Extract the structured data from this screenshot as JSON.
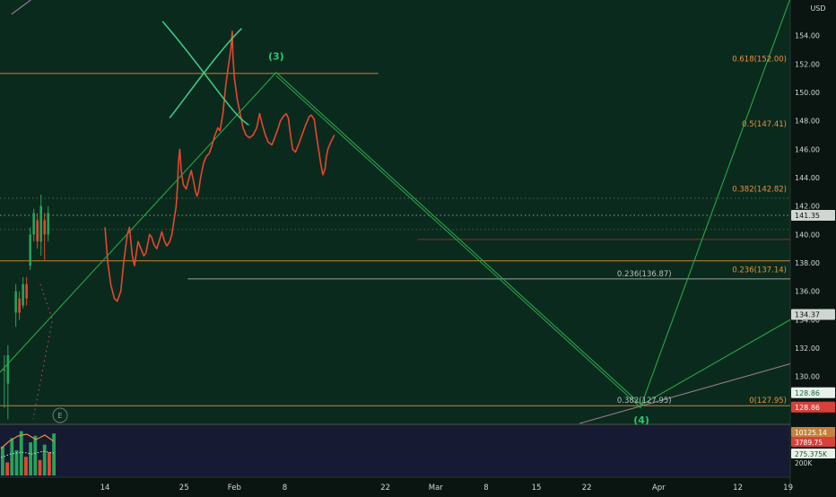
{
  "chart_data": {
    "type": "line",
    "currency": "USD",
    "y_ticks": [
      130,
      132,
      134,
      136,
      138,
      140,
      142,
      144,
      146,
      148,
      150,
      152,
      154
    ],
    "ylim": [
      126.7,
      156.5
    ],
    "x_ticks": [
      {
        "label": "14",
        "day": 14
      },
      {
        "label": "25",
        "day": 25
      },
      {
        "label": "Feb",
        "day": 32
      },
      {
        "label": "8",
        "day": 39
      },
      {
        "label": "22",
        "day": 53
      },
      {
        "label": "Mar",
        "day": 60
      },
      {
        "label": "8",
        "day": 67
      },
      {
        "label": "15",
        "day": 74
      },
      {
        "label": "22",
        "day": 81
      },
      {
        "label": "Apr",
        "day": 91
      },
      {
        "label": "12",
        "day": 102
      },
      {
        "label": "19",
        "day": 109
      }
    ],
    "xlim": [
      -0.6,
      109.3
    ],
    "price_series": {
      "name": "",
      "color": "#e5472e",
      "points": [
        [
          14.0,
          140.5
        ],
        [
          14.4,
          138.0
        ],
        [
          14.8,
          136.5
        ],
        [
          15.3,
          135.5
        ],
        [
          15.7,
          135.3
        ],
        [
          16.2,
          136.0
        ],
        [
          16.6,
          138.0
        ],
        [
          17.1,
          140.0
        ],
        [
          17.4,
          140.5
        ],
        [
          17.8,
          138.5
        ],
        [
          18.1,
          137.8
        ],
        [
          18.6,
          139.5
        ],
        [
          19.0,
          139.0
        ],
        [
          19.4,
          138.5
        ],
        [
          19.7,
          138.7
        ],
        [
          20.2,
          140.0
        ],
        [
          20.5,
          139.8
        ],
        [
          20.8,
          139.3
        ],
        [
          21.2,
          139.0
        ],
        [
          21.7,
          139.8
        ],
        [
          21.9,
          140.2
        ],
        [
          22.3,
          139.5
        ],
        [
          22.6,
          139.2
        ],
        [
          23.0,
          139.5
        ],
        [
          23.3,
          140.0
        ],
        [
          23.6,
          141.0
        ],
        [
          23.9,
          142.0
        ],
        [
          24.1,
          143.5
        ],
        [
          24.2,
          145.0
        ],
        [
          24.4,
          146.0
        ],
        [
          24.6,
          144.5
        ],
        [
          24.9,
          143.5
        ],
        [
          25.3,
          143.2
        ],
        [
          25.6,
          143.8
        ],
        [
          26.0,
          144.5
        ],
        [
          26.3,
          143.8
        ],
        [
          26.6,
          143.0
        ],
        [
          26.8,
          142.7
        ],
        [
          27.0,
          143.0
        ],
        [
          27.3,
          144.0
        ],
        [
          27.7,
          145.0
        ],
        [
          28.1,
          145.5
        ],
        [
          28.5,
          145.7
        ],
        [
          28.9,
          146.3
        ],
        [
          29.3,
          147.0
        ],
        [
          29.7,
          147.5
        ],
        [
          30.0,
          147.3
        ],
        [
          30.4,
          148.5
        ],
        [
          30.8,
          150.5
        ],
        [
          31.2,
          152.0
        ],
        [
          31.5,
          153.0
        ],
        [
          31.7,
          154.3
        ],
        [
          31.8,
          152.5
        ],
        [
          32.0,
          151.0
        ],
        [
          32.4,
          149.5
        ],
        [
          32.8,
          148.5
        ],
        [
          33.2,
          147.5
        ],
        [
          33.6,
          147.0
        ],
        [
          34.1,
          146.8
        ],
        [
          34.6,
          147.0
        ],
        [
          35.1,
          147.5
        ],
        [
          35.5,
          148.5
        ],
        [
          35.9,
          147.7
        ],
        [
          36.3,
          147.0
        ],
        [
          36.7,
          146.5
        ],
        [
          37.2,
          146.3
        ],
        [
          37.6,
          146.8
        ],
        [
          38.1,
          147.5
        ],
        [
          38.4,
          148.0
        ],
        [
          38.8,
          148.3
        ],
        [
          39.2,
          148.5
        ],
        [
          39.5,
          148.2
        ],
        [
          39.8,
          147.0
        ],
        [
          40.1,
          146.0
        ],
        [
          40.5,
          145.8
        ],
        [
          40.9,
          146.3
        ],
        [
          41.4,
          147.0
        ],
        [
          41.9,
          147.7
        ],
        [
          42.4,
          148.3
        ],
        [
          42.7,
          148.4
        ],
        [
          43.1,
          148.1
        ],
        [
          43.4,
          147.0
        ],
        [
          43.7,
          146.0
        ],
        [
          44.0,
          145.0
        ],
        [
          44.3,
          144.2
        ],
        [
          44.6,
          144.6
        ],
        [
          44.8,
          145.5
        ],
        [
          45.0,
          146.0
        ],
        [
          45.4,
          146.5
        ],
        [
          45.9,
          147.0
        ]
      ]
    },
    "candles": [
      {
        "day": 0.0,
        "open": 130.5,
        "close": 130.5,
        "high": 131.5,
        "low": 127.8,
        "color": "#27a35a"
      },
      {
        "day": 0.5,
        "open": 129.5,
        "close": 131.5,
        "high": 132.2,
        "low": 127.0,
        "color": "#27a35a"
      },
      {
        "day": 1.6,
        "open": 134.5,
        "close": 136.0,
        "high": 136.5,
        "low": 133.5,
        "color": "#27a35a"
      },
      {
        "day": 2.1,
        "open": 135.5,
        "close": 134.5,
        "high": 136.0,
        "low": 134.0,
        "color": "#e5472e"
      },
      {
        "day": 2.6,
        "open": 135.0,
        "close": 136.5,
        "high": 137.0,
        "low": 134.8,
        "color": "#27a35a"
      },
      {
        "day": 3.1,
        "open": 136.5,
        "close": 135.5,
        "high": 137.0,
        "low": 135.0,
        "color": "#e5472e"
      },
      {
        "day": 3.6,
        "open": 137.8,
        "close": 140.0,
        "high": 140.5,
        "low": 137.5,
        "color": "#27a35a"
      },
      {
        "day": 4.1,
        "open": 140.0,
        "close": 141.5,
        "high": 141.8,
        "low": 139.5,
        "color": "#27a35a"
      },
      {
        "day": 4.6,
        "open": 141.0,
        "close": 139.5,
        "high": 141.5,
        "low": 139.0,
        "color": "#e5472e"
      },
      {
        "day": 5.1,
        "open": 139.5,
        "close": 142.0,
        "high": 142.8,
        "low": 138.5,
        "color": "#27a35a"
      },
      {
        "day": 5.6,
        "open": 141.0,
        "close": 140.0,
        "high": 141.5,
        "low": 138.2,
        "color": "#e5472e"
      },
      {
        "day": 6.1,
        "open": 140.0,
        "close": 141.5,
        "high": 142.0,
        "low": 139.5,
        "color": "#27a35a"
      }
    ],
    "horizontal_levels": [
      {
        "y": 151.33,
        "day_start": -0.6,
        "day_end": 52.0,
        "color": "#c8813a"
      },
      {
        "y": 142.55,
        "day_start": -0.6,
        "day_end": 109.3,
        "color": "#556055",
        "dashed": true
      },
      {
        "y": 141.35,
        "day_start": -0.6,
        "day_end": 109.3,
        "color": "#8a9a8a",
        "dashed": true
      },
      {
        "y": 140.35,
        "day_start": -0.6,
        "day_end": 109.3,
        "color": "#4a5a4e",
        "dashed": true
      },
      {
        "y": 139.65,
        "day_start": 57.5,
        "day_end": 109.3,
        "color": "#8a2e2e"
      },
      {
        "y": 138.14,
        "day_start": -0.6,
        "day_end": 109.3,
        "color": "#c8813a"
      },
      {
        "y": 136.87,
        "day_start": 25.5,
        "day_end": 109.3,
        "color": "#9aa2a0"
      },
      {
        "y": 127.95,
        "day_start": -0.6,
        "day_end": 109.3,
        "color": "#c8813a"
      }
    ],
    "fib_labels": [
      {
        "text": "0.618(152.00)",
        "y": 152.0,
        "color": "#e8903a"
      },
      {
        "text": "0.5(147.41)",
        "y": 147.41,
        "color": "#e8903a"
      },
      {
        "text": "0.382(142.82)",
        "y": 142.82,
        "color": "#e8903a"
      },
      {
        "text": "0.236(137.14)",
        "y": 137.14,
        "color": "#e8903a"
      },
      {
        "text": "0(127.95)",
        "y": 127.95,
        "color": "#e8903a"
      }
    ],
    "wave_fib_labels": [
      {
        "text": "0.236(136.87)",
        "y": 136.87,
        "day": 89.0,
        "color": "#b8c0bc"
      },
      {
        "text": "0.382(127.95)",
        "y": 127.95,
        "day": 89.0,
        "color": "#b8c0bc"
      }
    ],
    "trend_lines": [
      {
        "points": [
          [
            -0.6,
            130.3
          ],
          [
            37.8,
            151.4
          ],
          [
            88.6,
            128.0
          ],
          [
            109.3,
            156.6
          ]
        ],
        "color": "#27a645"
      },
      {
        "points": [
          [
            37.8,
            151.4
          ],
          [
            88.6,
            128.0
          ]
        ],
        "color": "#2f9b4a",
        "offset": 1.2
      },
      {
        "points": [
          [
            88.6,
            128.0
          ],
          [
            109.3,
            134.0
          ]
        ],
        "color": "#27a645"
      },
      {
        "points": [
          [
            80.0,
            126.7
          ],
          [
            109.3,
            130.9
          ]
        ],
        "color": "#9a7d8a"
      },
      {
        "points": [
          [
            1.0,
            155.5
          ],
          [
            5.0,
            157.0
          ]
        ],
        "color": "#a37aa3"
      },
      {
        "points": [
          [
            5.0,
            136.5
          ],
          [
            6.7,
            134.0
          ],
          [
            4.0,
            127.0
          ]
        ],
        "color": "#cc4444",
        "dashed": true
      }
    ],
    "x_pattern": [
      {
        "points": [
          [
            22.0,
            155.0
          ],
          [
            28.0,
            151.5
          ],
          [
            31.5,
            148.5
          ],
          [
            34.0,
            147.7
          ]
        ],
        "color": "#3fcf88"
      },
      {
        "points": [
          [
            23.0,
            148.2
          ],
          [
            26.5,
            150.5
          ],
          [
            30.0,
            153.0
          ],
          [
            33.0,
            154.5
          ]
        ],
        "color": "#3fcf88"
      }
    ],
    "wave_labels": [
      {
        "text": "(3)",
        "day": 37.8,
        "y": 152.3,
        "color": "#2fc46b"
      },
      {
        "text": "(4)",
        "day": 88.6,
        "y": 126.7,
        "color": "#2fc46b"
      }
    ],
    "event_marker": "E",
    "price_badges": [
      {
        "text": "141.35",
        "y": 141.35,
        "bg": "#d0d6d2",
        "fg": "#111111"
      },
      {
        "text": "134.37",
        "y": 134.37,
        "bg": "#d0d6d2",
        "fg": "#111111"
      },
      {
        "text": "128.86",
        "y": 128.86,
        "bg": "#e8f2ea",
        "fg": "#1a6a3a"
      },
      {
        "text": "128.86",
        "y": 127.85,
        "bg": "#d8403a",
        "fg": "#ffffff"
      }
    ],
    "volume_pane": {
      "labels": [
        {
          "text": "10125.14",
          "bg": "#c8813a",
          "fg": "#ffffff"
        },
        {
          "text": "3789.75",
          "bg": "#d8403a",
          "fg": "#ffffff"
        },
        {
          "text": "275.375K",
          "bg": "#e8f2ea",
          "fg": "#1a5a3a"
        },
        {
          "text": "200K",
          "bg": "",
          "fg": "#cfd8d4"
        }
      ],
      "bars": [
        62,
        28,
        80,
        54,
        95,
        40,
        71,
        85,
        33,
        66,
        50,
        90
      ],
      "colors": [
        "#27a35a",
        "#e5472e",
        "#27a35a",
        "#27a35a",
        "#27a35a",
        "#e5472e",
        "#27a35a",
        "#27a35a",
        "#e5472e",
        "#27a35a",
        "#e5472e",
        "#27a35a"
      ]
    }
  }
}
